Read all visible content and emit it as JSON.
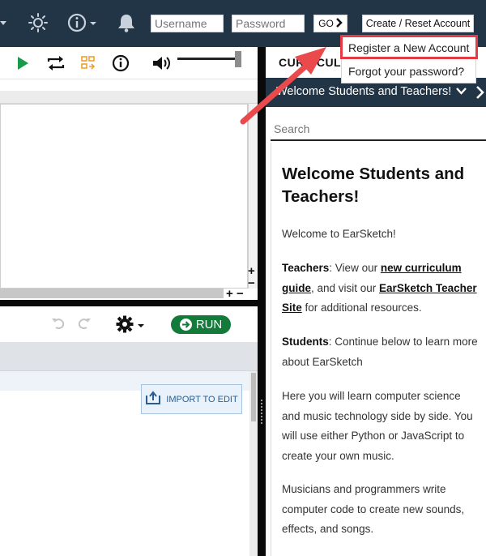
{
  "topbar": {
    "username_placeholder": "Username",
    "password_placeholder": "Password",
    "go_label": "GO",
    "create_reset_label": "Create / Reset Account"
  },
  "account_menu": {
    "register_label": "Register a New Account",
    "forgot_label": "Forgot your password?"
  },
  "editor": {
    "run_label": "RUN",
    "import_label": "IMPORT TO EDIT"
  },
  "curriculum": {
    "header_title": "CURRICULUM",
    "nav_title": "Welcome Students and Teachers!",
    "search_placeholder": "Search",
    "heading": "Welcome Students and Teachers!",
    "intro": "Welcome to EarSketch!",
    "teachers_label": "Teachers",
    "teachers_text_1": ": View our ",
    "teachers_link_1": "new curriculum guide",
    "teachers_text_2": ", and visit our ",
    "teachers_link_2": "EarSketch Teacher Site",
    "teachers_text_3": " for additional resources.",
    "students_label": "Students",
    "students_text": ": Continue below to learn more about EarSketch",
    "para_learn": "Here you will learn computer science and music technology side by side. You will use either Python or JavaScript to create your own music.",
    "para_musicians": "Musicians and programmers write computer code to create new sounds, effects, and songs."
  },
  "colors": {
    "topbar_bg": "#223546",
    "run_green": "#137a3a",
    "highlight_red": "#e53b45",
    "play_green": "#1a9a4b",
    "loop_orange": "#f0a030"
  },
  "icons": [
    "brightness-icon",
    "info-icon",
    "bell-icon",
    "chevron-right-icon",
    "play-icon",
    "loop-icon",
    "metronome-icon",
    "info-circle-icon",
    "volume-icon",
    "undo-icon",
    "redo-icon",
    "gear-icon",
    "run-arrow-icon",
    "import-icon"
  ]
}
